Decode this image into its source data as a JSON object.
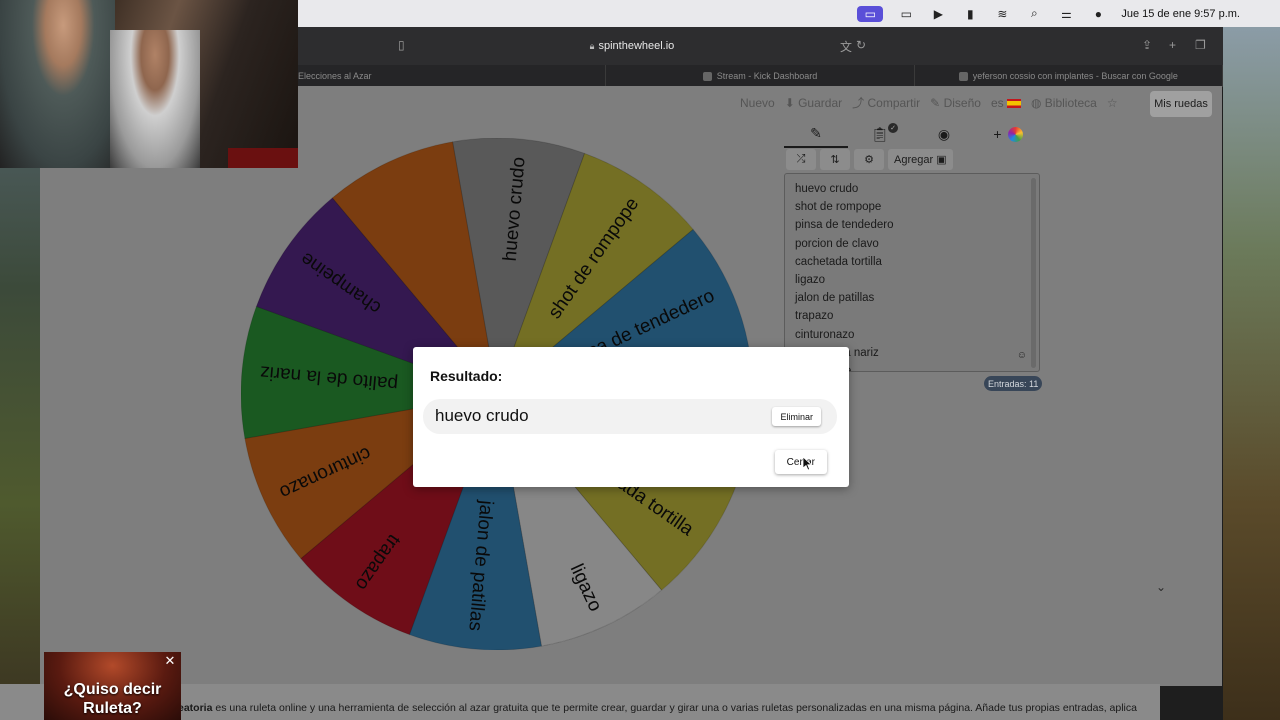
{
  "menubar": {
    "date_time": "Jue 15 de ene  9:57 p.m."
  },
  "browser": {
    "url": "spinthewheel.io",
    "tabs": [
      {
        "label": "Elecciones al Azar"
      },
      {
        "label": "Stream - Kick Dashboard"
      },
      {
        "label": "yeferson cossio con implantes - Buscar con Google"
      }
    ]
  },
  "topnav": {
    "new": "Nuevo",
    "save": "Guardar",
    "share": "Compartir",
    "design": "Diseño",
    "lang": "es",
    "library": "Biblioteca",
    "my_wheels": "Mis ruedas"
  },
  "editor": {
    "add_image": "Agregar",
    "entries_count": "Entradas: 11",
    "entries": [
      "huevo crudo",
      "shot de rompope",
      "pinsa de tendedero",
      "porcion de clavo",
      "cachetada tortilla",
      "ligazo",
      "jalon de patillas",
      "trapazo",
      "cinturonazo",
      "palito de la nariz",
      "champeine"
    ]
  },
  "wheel": {
    "segments": [
      {
        "label": "huevo crudo",
        "color": "#9a9a9a"
      },
      {
        "label": "shot de rompope",
        "color": "#c8c03e"
      },
      {
        "label": "pinsa de tendedero",
        "color": "#3a8ac0"
      },
      {
        "label": "porcion de clavo",
        "color": "#2e9a3a"
      },
      {
        "label": "cachetada tortilla",
        "color": "#c8c03e"
      },
      {
        "label": "ligazo",
        "color": "#e8e8e8"
      },
      {
        "label": "jalon de patillas",
        "color": "#3a8ac0"
      },
      {
        "label": "trapazo",
        "color": "#c0182a"
      },
      {
        "label": "cinturonazo",
        "color": "#d46a1c"
      },
      {
        "label": "palito de la nariz",
        "color": "#2e9a3a"
      },
      {
        "label": "champeine",
        "color": "#5a2a8a"
      },
      {
        "label": "",
        "color": "#d46a1c"
      }
    ]
  },
  "modal": {
    "title": "Resultado:",
    "result": "huevo crudo",
    "delete_label": "Eliminar",
    "close_label": "Cerrar"
  },
  "description": {
    "bold": "eatoria",
    "text": " es una ruleta online y una herramienta de selección al azar gratuita que te permite crear, guardar y girar una o varias ruletas personalizadas en una misma página. Añade tus propias entradas, aplica"
  },
  "ad": {
    "text_line1": "¿Quiso decir",
    "text_line2": "Ruleta?"
  }
}
